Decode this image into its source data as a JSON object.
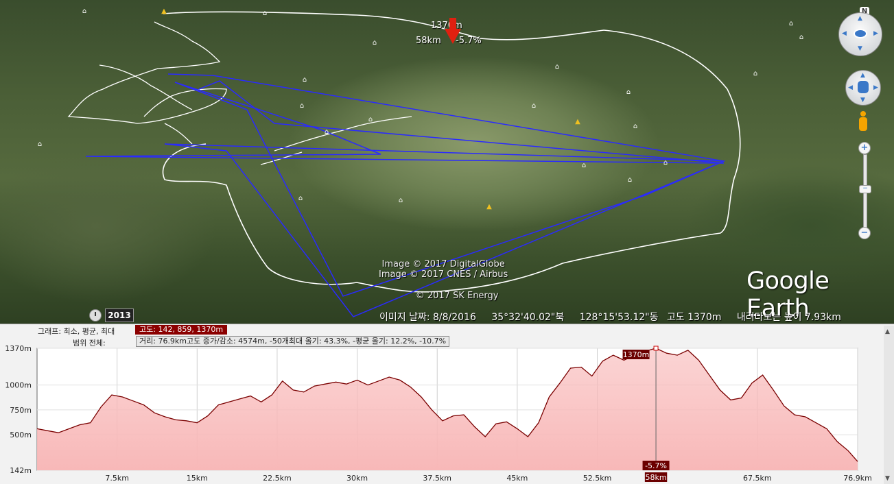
{
  "map": {
    "marker": {
      "altitude": "1370m",
      "distance": "58km",
      "grade": "-5.7%"
    },
    "copyright": [
      "Image © 2017 DigitalGlobe",
      "Image © 2017 CNES / Airbus",
      "© 2017 SK Energy"
    ],
    "logo": "Google Earth",
    "history_year": "2013",
    "status": {
      "imagery_date": "이미지 날짜: 8/8/2016",
      "lat": "35°32'40.02\"북",
      "lon": "128°15'53.12\"동",
      "altitude": "고도  1370m",
      "eye_alt": "내려다보는 높이   7.93km"
    },
    "nav": {
      "north": "N",
      "zoom_in": "+",
      "zoom_out": "−"
    },
    "colors": {
      "gps_track": "#ffffff",
      "flight_path": "#2a2aff"
    }
  },
  "profile": {
    "graph_label": "그래프: 최소, 평균, 최대",
    "graph_value": "고도: 142, 859, 1370m",
    "range_label": "범위 전체:",
    "range_stats": "거리: 76.9km고도 증가/감소: 4574m, -50개최대 올기: 43.3%, -평균 올기: 12.2%, -10.7%",
    "close": "×",
    "cursor": {
      "km": 58,
      "altitude_label": "1370m",
      "km_label": "58km",
      "grade_label": "-5.7%"
    }
  },
  "chart_data": {
    "type": "area",
    "title": "",
    "xlabel": "",
    "ylabel": "",
    "xlim": [
      0,
      76.9
    ],
    "ylim": [
      142,
      1370
    ],
    "x_ticks": [
      "7.5km",
      "15km",
      "22.5km",
      "30km",
      "37.5km",
      "45km",
      "52.5km",
      "58km",
      "67.5km",
      "76.9km"
    ],
    "x_tick_values": [
      7.5,
      15,
      22.5,
      30,
      37.5,
      45,
      52.5,
      58,
      67.5,
      76.9
    ],
    "y_ticks": [
      "1370m",
      "1000m",
      "750m",
      "500m",
      "142m"
    ],
    "y_tick_values": [
      1370,
      1000,
      750,
      500,
      142
    ],
    "color": "#7a0000",
    "fill": "#f8b8b8",
    "x": [
      0,
      1,
      2,
      3,
      4,
      5,
      6,
      7,
      8,
      9,
      10,
      11,
      12,
      13,
      14,
      15,
      16,
      17,
      18,
      19,
      20,
      21,
      22,
      23,
      24,
      25,
      26,
      27,
      28,
      29,
      30,
      31,
      32,
      33,
      34,
      35,
      36,
      37,
      38,
      39,
      40,
      41,
      42,
      43,
      44,
      45,
      46,
      47,
      48,
      49,
      50,
      51,
      52,
      53,
      54,
      55,
      56,
      57,
      58,
      59,
      60,
      61,
      62,
      63,
      64,
      65,
      66,
      67,
      68,
      69,
      70,
      71,
      72,
      73,
      74,
      75,
      76,
      76.9
    ],
    "y": [
      560,
      540,
      520,
      560,
      600,
      620,
      780,
      900,
      880,
      840,
      800,
      720,
      680,
      650,
      640,
      620,
      690,
      800,
      830,
      860,
      890,
      830,
      900,
      1040,
      950,
      930,
      990,
      1010,
      1030,
      1010,
      1050,
      1000,
      1040,
      1080,
      1050,
      980,
      880,
      750,
      640,
      690,
      700,
      580,
      480,
      610,
      630,
      560,
      480,
      620,
      880,
      1020,
      1170,
      1180,
      1090,
      1240,
      1300,
      1250,
      1300,
      1340,
      1370,
      1320,
      1300,
      1350,
      1250,
      1100,
      950,
      850,
      870,
      1020,
      1100,
      950,
      790,
      700,
      680,
      620,
      560,
      430,
      340,
      230
    ]
  }
}
